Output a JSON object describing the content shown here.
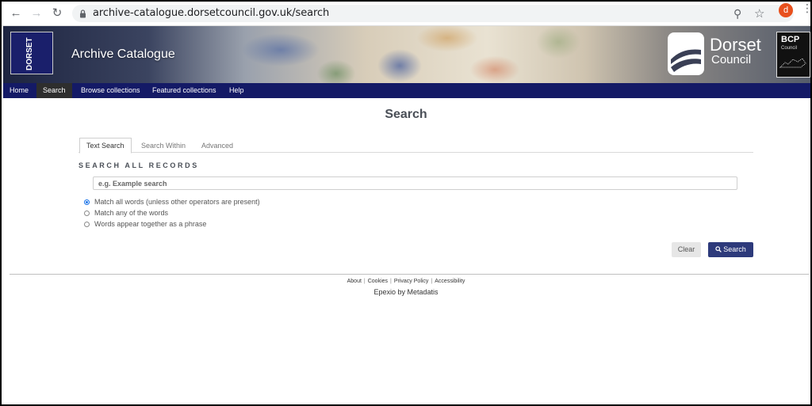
{
  "browser": {
    "url": "archive-catalogue.dorsetcouncil.gov.uk/search",
    "profile_initial": "d"
  },
  "header": {
    "council_logo_text": "DORSET",
    "site_title": "Archive Catalogue",
    "dorset_name": "Dorset",
    "dorset_sub": "Council",
    "bcp_title": "BCP",
    "bcp_sub": "Council"
  },
  "nav": {
    "items": [
      {
        "label": "Home"
      },
      {
        "label": "Search"
      },
      {
        "label": "Browse collections"
      },
      {
        "label": "Featured collections"
      },
      {
        "label": "Help"
      }
    ],
    "active": "Search"
  },
  "main": {
    "title": "Search",
    "tabs": [
      {
        "label": "Text Search"
      },
      {
        "label": "Search Within"
      },
      {
        "label": "Advanced"
      }
    ],
    "section_heading": "SEARCH ALL RECORDS",
    "search_placeholder": "e.g. Example search",
    "options": [
      {
        "label": "Match all words (unless other operators are present)",
        "checked": true
      },
      {
        "label": "Match any of the words",
        "checked": false
      },
      {
        "label": "Words appear together as a phrase",
        "checked": false
      }
    ],
    "clear_label": "Clear",
    "search_label": "Search"
  },
  "footer": {
    "links": [
      "About",
      "Cookies",
      "Privacy Policy",
      "Accessibility"
    ],
    "credit": "Epexio by Metadatis"
  },
  "colors": {
    "nav_bg": "#141a66",
    "search_button": "#2d3a7b",
    "avatar": "#e8501d"
  }
}
